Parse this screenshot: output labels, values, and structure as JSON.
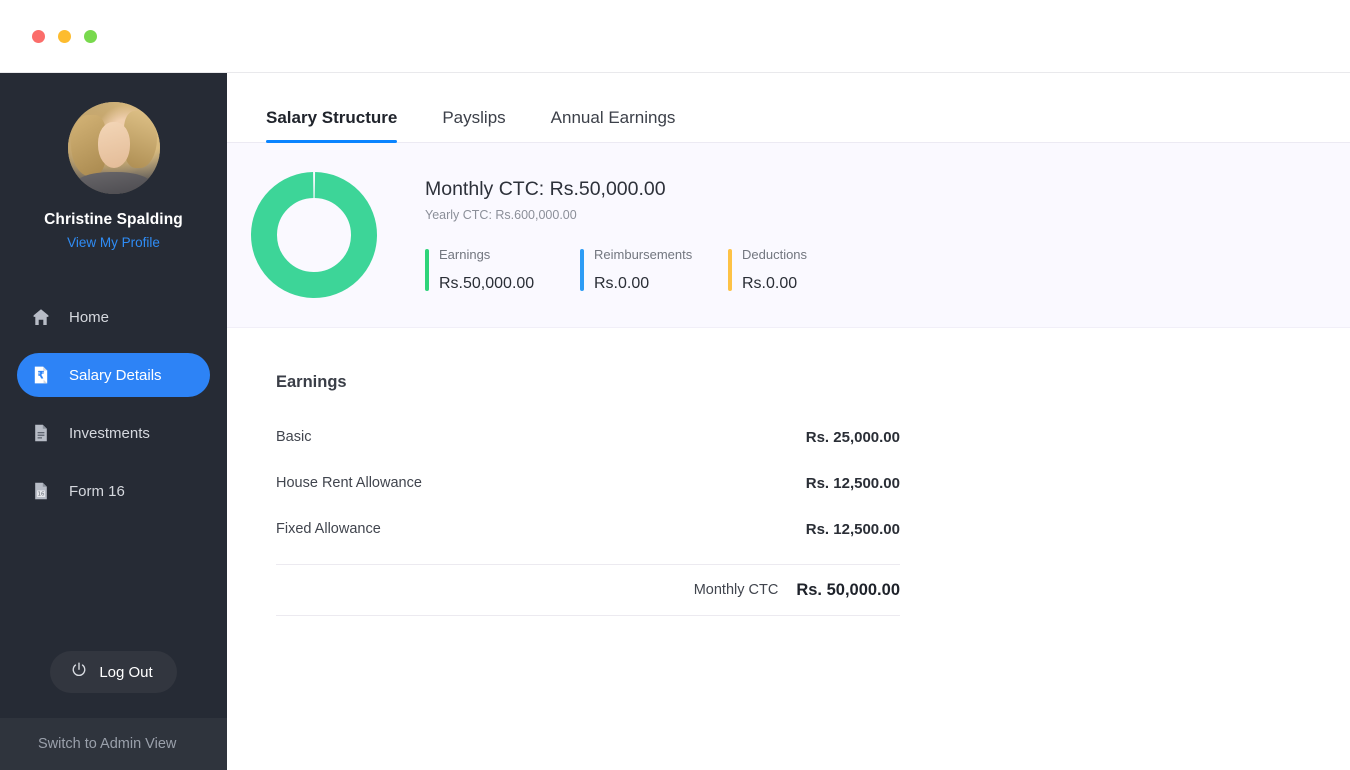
{
  "window": {
    "traffic_lights": [
      "close",
      "minimize",
      "maximize"
    ],
    "colors": {
      "red": "#fb6d6a",
      "yellow": "#fdbc2f",
      "green": "#78d94d"
    }
  },
  "sidebar": {
    "user": {
      "name": "Christine Spalding",
      "profile_link": "View My Profile",
      "avatar": "user-photo"
    },
    "items": [
      {
        "label": "Home",
        "icon": "home-icon",
        "active": false
      },
      {
        "label": "Salary Details",
        "icon": "rupee-document-icon",
        "active": true
      },
      {
        "label": "Investments",
        "icon": "document-lines-icon",
        "active": false
      },
      {
        "label": "Form 16",
        "icon": "form-16-document-icon",
        "active": false
      }
    ],
    "logout": {
      "label": "Log Out",
      "icon": "power-icon"
    },
    "admin_switch": "Switch to Admin View",
    "accent_color": "#2d83f6",
    "background_color": "#262b35"
  },
  "main": {
    "tabs": [
      {
        "label": "Salary Structure",
        "active": true
      },
      {
        "label": "Payslips",
        "active": false
      },
      {
        "label": "Annual Earnings",
        "active": false
      }
    ],
    "summary": {
      "monthly_ctc": "Monthly CTC: Rs.50,000.00",
      "yearly_ctc": "Yearly CTC: Rs.600,000.00",
      "stats": [
        {
          "label": "Earnings",
          "value": "Rs.50,000.00",
          "color": "#2ed47a"
        },
        {
          "label": "Reimbursements",
          "value": "Rs.0.00",
          "color": "#2d9cf5"
        },
        {
          "label": "Deductions",
          "value": "Rs.0.00",
          "color": "#fdc246"
        }
      ]
    },
    "earnings": {
      "title": "Earnings",
      "rows": [
        {
          "name": "Basic",
          "amount": "Rs. 25,000.00"
        },
        {
          "name": "House Rent Allowance",
          "amount": "Rs. 12,500.00"
        },
        {
          "name": "Fixed Allowance",
          "amount": "Rs. 12,500.00"
        }
      ],
      "total": {
        "label": "Monthly CTC",
        "amount": "Rs. 50,000.00"
      }
    }
  },
  "chart_data": {
    "type": "pie",
    "title": "Monthly CTC composition",
    "categories": [
      "Earnings",
      "Reimbursements",
      "Deductions"
    ],
    "values": [
      50000,
      0,
      0
    ],
    "percentages": [
      100,
      0,
      0
    ],
    "colors": [
      "#3dd598",
      "#2d9cf5",
      "#fdc246"
    ],
    "donut": true,
    "legend": "right"
  }
}
